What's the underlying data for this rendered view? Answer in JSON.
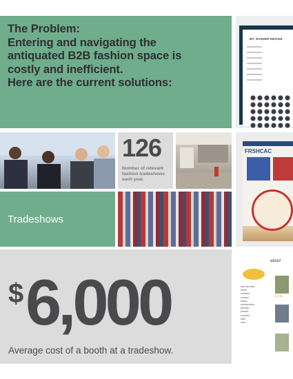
{
  "problem": {
    "lines": [
      "The Problem:",
      "Entering and navigating the",
      "antiquated B2B fashion space is",
      "costly and inefficient.",
      "Here are the current solutions:"
    ]
  },
  "stat": {
    "number": "126",
    "description": "Number of relevant fashion tradeshows each year."
  },
  "tradeshows": {
    "label": "Tradeshows"
  },
  "cost": {
    "dollar": "$",
    "amount": "6,000",
    "caption": "Average cost of a booth at a tradeshow."
  },
  "shots": {
    "one": {
      "brand": "MT. RAINIER DESIGN"
    },
    "two": {
      "logo": "FRSHCAC"
    },
    "three": {
      "title": "about",
      "nav": [
        "new arrivals",
        "home",
        "children",
        "women",
        "tunics",
        "accessories",
        "jewelry",
        "purses",
        "scarves",
        "sale",
        "men"
      ],
      "caption": "$74.95"
    }
  },
  "colors": {
    "green": "#6fad8d",
    "grey": "#dcdcdc",
    "text": "#4a4a4c"
  }
}
